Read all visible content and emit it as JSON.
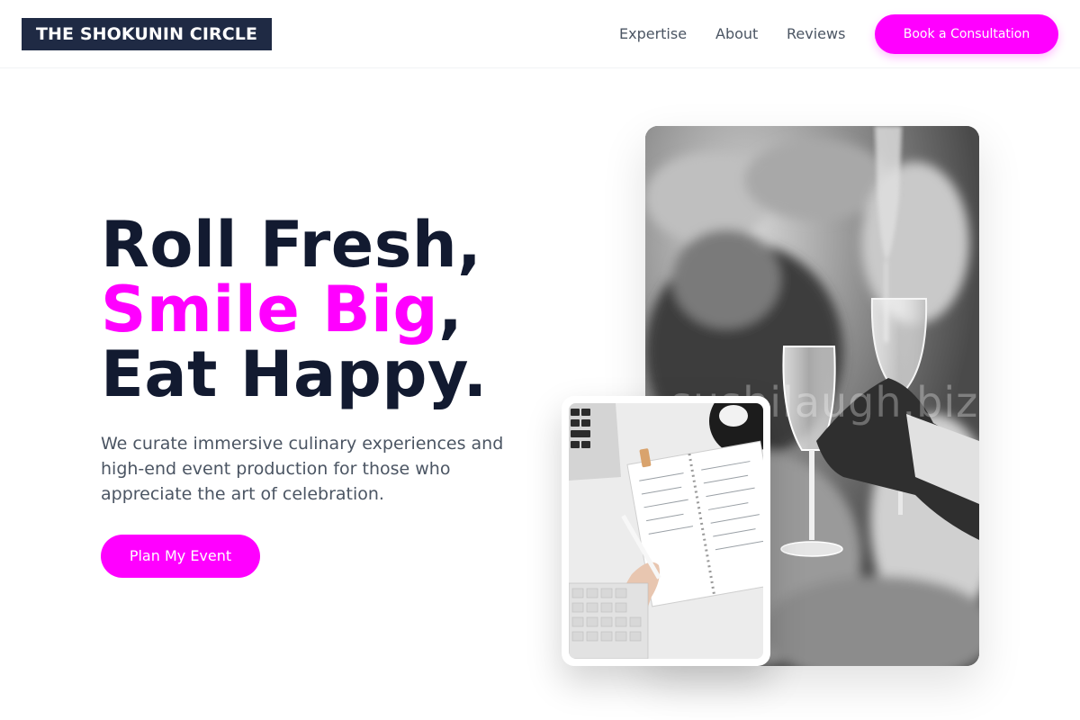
{
  "brand": {
    "name": "THE SHOKUNIN CIRCLE"
  },
  "nav": {
    "items": [
      {
        "label": "Expertise"
      },
      {
        "label": "About"
      },
      {
        "label": "Reviews"
      }
    ],
    "cta_label": "Book a Consultation"
  },
  "hero": {
    "headline_line1": "Roll Fresh,",
    "headline_accent": "Smile Big",
    "headline_comma": ",",
    "headline_line3": "Eat Happy.",
    "description": "We curate immersive culinary experiences and high-end event production for those who appreciate the art of celebration.",
    "button_label": "Plan My Event",
    "watermark": "sushilaugh.biz"
  },
  "colors": {
    "accent": "#ff00ff",
    "logo_bg": "#1f2a44",
    "heading": "#121a30",
    "body_text": "#4b5563"
  },
  "icons": {
    "main_photo": "champagne-toast-photo",
    "small_photo": "planner-notebook-photo"
  }
}
